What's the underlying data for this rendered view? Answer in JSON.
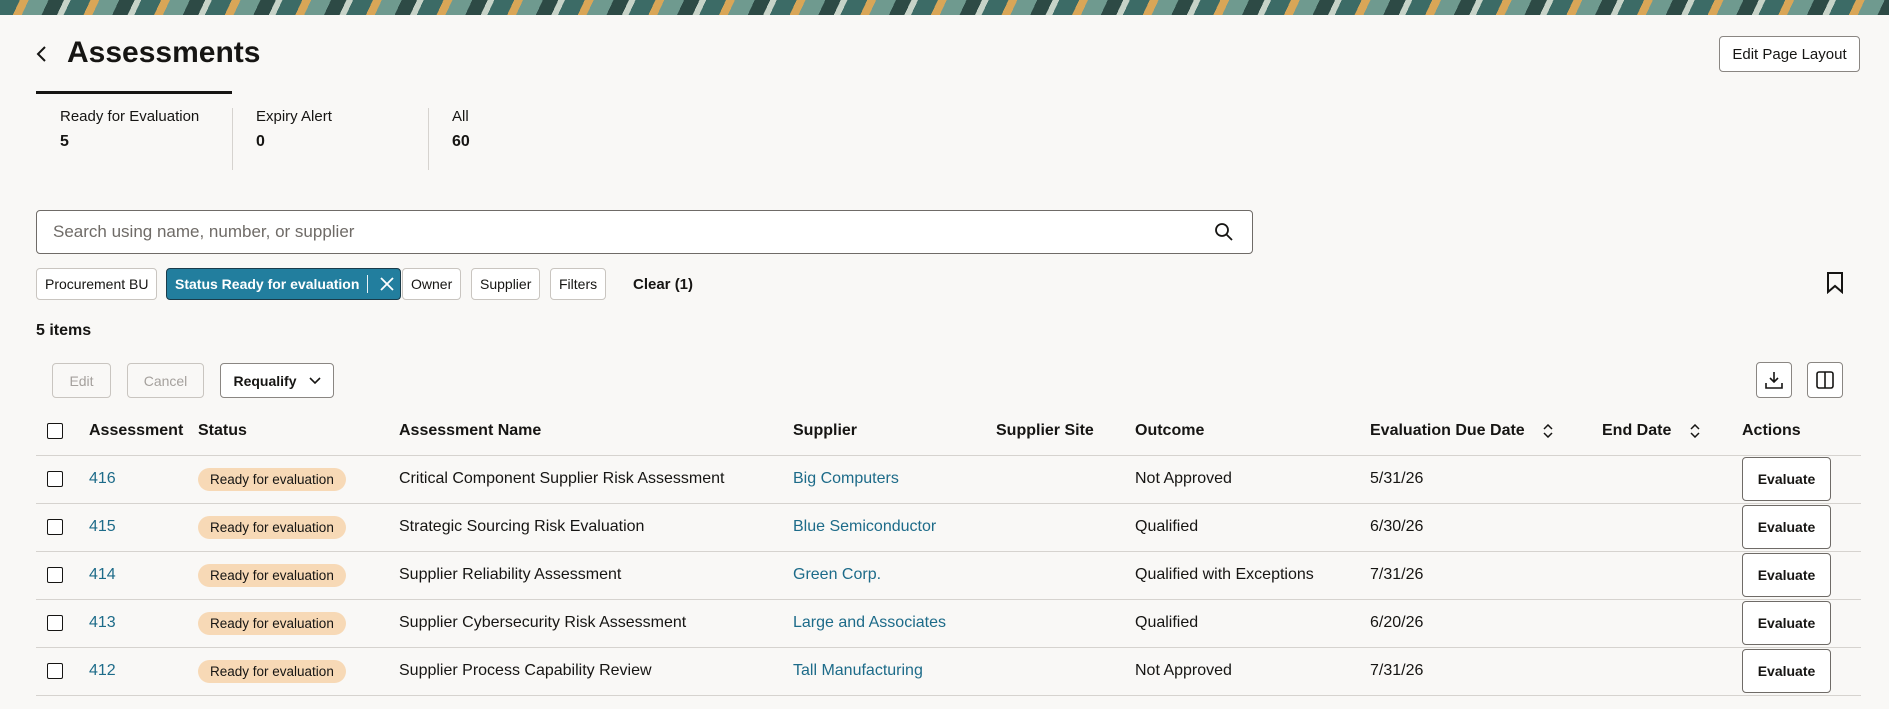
{
  "header": {
    "title": "Assessments",
    "edit_layout_label": "Edit Page Layout"
  },
  "tabs": [
    {
      "label": "Ready for Evaluation",
      "count": "5"
    },
    {
      "label": "Expiry Alert",
      "count": "0"
    },
    {
      "label": "All",
      "count": "60"
    }
  ],
  "search": {
    "placeholder": "Search using name, number, or supplier",
    "value": ""
  },
  "filters": {
    "chips": [
      "Procurement BU",
      "Status Ready for evaluation",
      "Owner",
      "Supplier",
      "Filters"
    ],
    "active_chip_index": 1,
    "clear_label": "Clear (1)"
  },
  "results": {
    "count_label": "5 items"
  },
  "toolbar": {
    "edit_label": "Edit",
    "cancel_label": "Cancel",
    "requalify_label": "Requalify"
  },
  "table": {
    "columns": [
      "Assessment",
      "Status",
      "Assessment Name",
      "Supplier",
      "Supplier Site",
      "Outcome",
      "Evaluation Due Date",
      "End Date",
      "Actions"
    ],
    "rows": [
      {
        "number": "416",
        "status": "Ready for evaluation",
        "name": "Critical Component Supplier Risk Assessment",
        "supplier": "Big Computers",
        "site": "",
        "outcome": "Not Approved",
        "due": "5/31/26",
        "end": "",
        "action": "Evaluate"
      },
      {
        "number": "415",
        "status": "Ready for evaluation",
        "name": "Strategic Sourcing Risk Evaluation",
        "supplier": "Blue Semiconductor",
        "site": "",
        "outcome": "Qualified",
        "due": "6/30/26",
        "end": "",
        "action": "Evaluate"
      },
      {
        "number": "414",
        "status": "Ready for evaluation",
        "name": "Supplier Reliability Assessment",
        "supplier": "Green Corp.",
        "site": "",
        "outcome": "Qualified with Exceptions",
        "due": "7/31/26",
        "end": "",
        "action": "Evaluate"
      },
      {
        "number": "413",
        "status": "Ready for evaluation",
        "name": "Supplier Cybersecurity Risk Assessment",
        "supplier": "Large and Associates",
        "site": "",
        "outcome": "Qualified",
        "due": "6/20/26",
        "end": "",
        "action": "Evaluate"
      },
      {
        "number": "412",
        "status": "Ready for evaluation",
        "name": "Supplier Process Capability Review",
        "supplier": "Tall Manufacturing",
        "site": "",
        "outcome": "Not Approved",
        "due": "7/31/26",
        "end": "",
        "action": "Evaluate"
      }
    ]
  },
  "colors": {
    "link": "#1d6b89",
    "active_chip": "#227e9e",
    "badge_bg": "#f7d9b6",
    "page_bg": "#f9f8f6"
  }
}
